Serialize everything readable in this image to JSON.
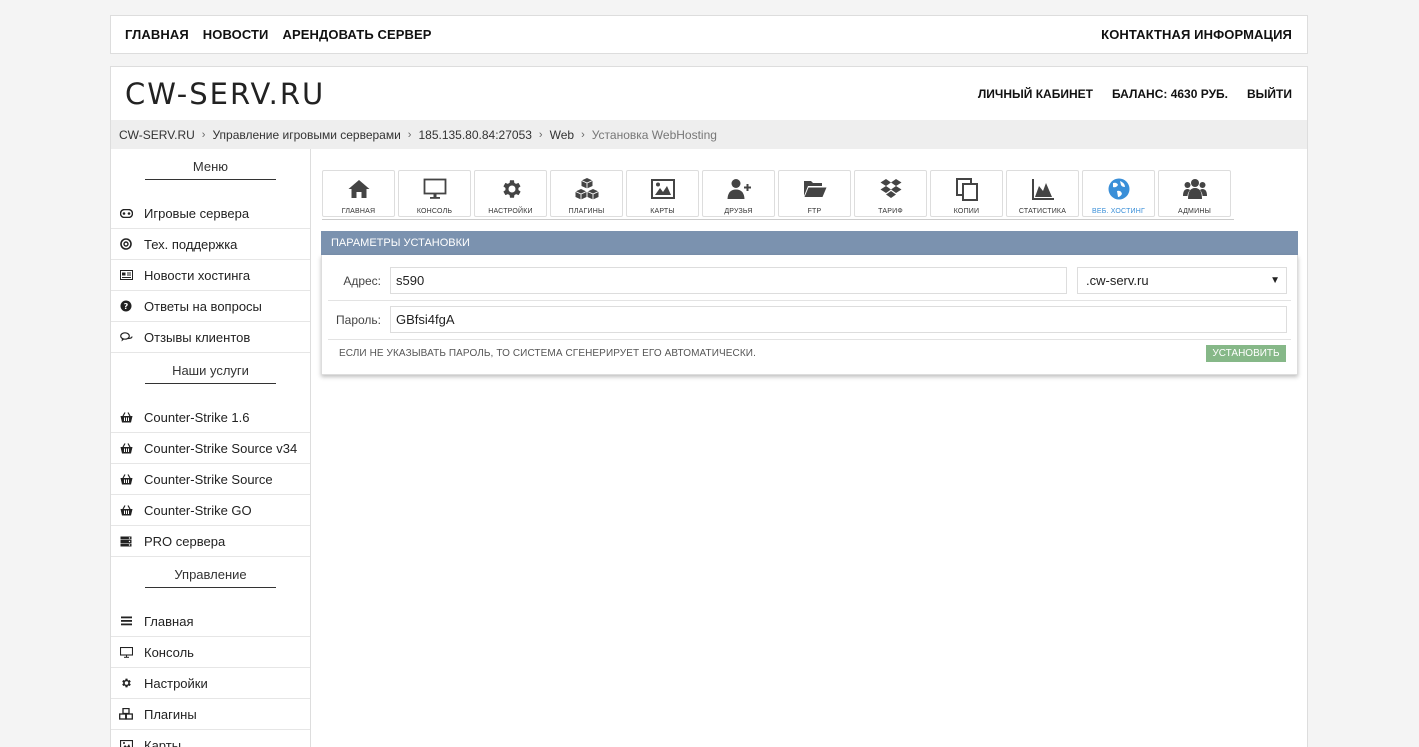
{
  "topnav": {
    "home": "ГЛАВНАЯ",
    "news": "НОВОСТИ",
    "rent": "АРЕНДОВАТЬ СЕРВЕР",
    "contacts": "КОНТАКТНАЯ ИНФОРМАЦИЯ"
  },
  "header": {
    "logo": "CW-SERV.RU",
    "cabinet": "ЛИЧНЫЙ КАБИНЕТ",
    "balance": "БАЛАНС: 4630 РУБ.",
    "logout": "ВЫЙТИ"
  },
  "breadcrumb": [
    "CW-SERV.RU",
    "Управление игровыми серверами",
    "185.135.80.84:27053",
    "Web",
    "Установка WebHosting"
  ],
  "sidebar": {
    "menu_title": "Меню",
    "menu": [
      {
        "label": "Игровые сервера",
        "icon": "gamepad-icon"
      },
      {
        "label": "Тех. поддержка",
        "icon": "lifebuoy-icon"
      },
      {
        "label": "Новости хостинга",
        "icon": "newspaper-icon"
      },
      {
        "label": "Ответы на вопросы",
        "icon": "question-icon"
      },
      {
        "label": "Отзывы клиентов",
        "icon": "comments-icon"
      }
    ],
    "services_title": "Наши услуги",
    "services": [
      {
        "label": "Counter-Strike 1.6",
        "icon": "basket-icon"
      },
      {
        "label": "Counter-Strike Source v34",
        "icon": "basket-icon"
      },
      {
        "label": "Counter-Strike Source",
        "icon": "basket-icon"
      },
      {
        "label": "Counter-Strike GO",
        "icon": "basket-icon"
      },
      {
        "label": "PRO сервера",
        "icon": "server-icon"
      }
    ],
    "manage_title": "Управление",
    "manage": [
      {
        "label": "Главная",
        "icon": "list-icon"
      },
      {
        "label": "Консоль",
        "icon": "monitor-icon"
      },
      {
        "label": "Настройки",
        "icon": "gear-icon"
      },
      {
        "label": "Плагины",
        "icon": "cubes-icon"
      },
      {
        "label": "Карты",
        "icon": "image-icon"
      }
    ]
  },
  "tabs": [
    {
      "label": "ГЛАВНАЯ",
      "icon": "home-icon"
    },
    {
      "label": "КОНСОЛЬ",
      "icon": "monitor-icon"
    },
    {
      "label": "НАСТРОЙКИ",
      "icon": "gear-icon"
    },
    {
      "label": "ПЛАГИНЫ",
      "icon": "cubes-icon"
    },
    {
      "label": "КАРТЫ",
      "icon": "image-icon"
    },
    {
      "label": "ДРУЗЬЯ",
      "icon": "user-plus-icon"
    },
    {
      "label": "FTP",
      "icon": "folder-open-icon"
    },
    {
      "label": "ТАРИФ",
      "icon": "dropbox-icon"
    },
    {
      "label": "КОПИИ",
      "icon": "copy-icon"
    },
    {
      "label": "СТАТИСТИКА",
      "icon": "area-chart-icon"
    },
    {
      "label": "ВЕБ. ХОСТИНГ",
      "icon": "globe-icon",
      "active": true
    },
    {
      "label": "АДМИНЫ",
      "icon": "users-icon"
    }
  ],
  "colors": {
    "accent": "#3a8fd8",
    "panel_head": "#7b92af",
    "button": "#86b888"
  },
  "panel": {
    "title": "ПАРАМЕТРЫ УСТАНОВКИ",
    "address_label": "Адрес:",
    "address_value": "s590",
    "domain_value": ".cw-serv.ru",
    "password_label": "Пароль:",
    "password_value": "GBfsi4fgA",
    "note": "ЕСЛИ НЕ УКАЗЫВАТЬ ПАРОЛЬ, ТО СИСТЕМА СГЕНЕРИРУЕТ ЕГО АВТОМАТИЧЕСКИ.",
    "install_button": "УСТАНОВИТЬ"
  }
}
